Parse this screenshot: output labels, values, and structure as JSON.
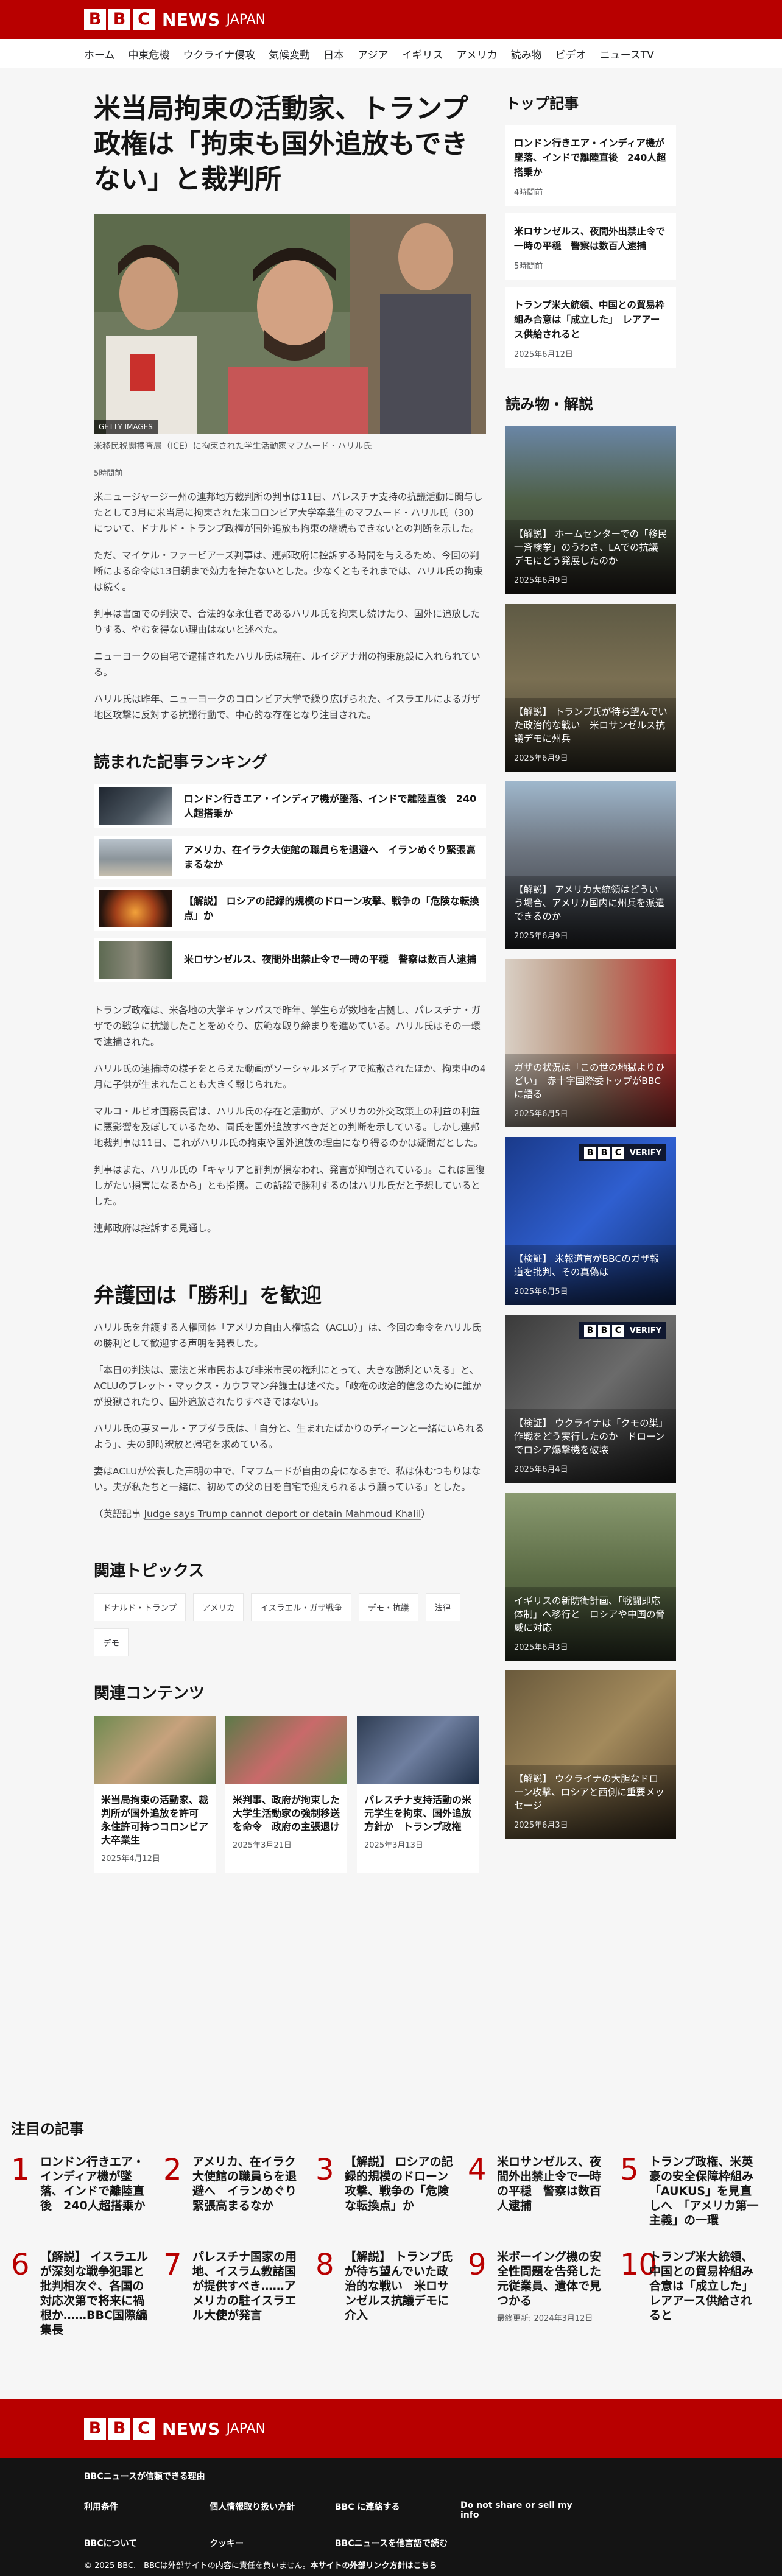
{
  "brand": {
    "blocks": [
      "B",
      "B",
      "C"
    ],
    "news": "NEWS",
    "edition": "JAPAN"
  },
  "nav": [
    "ホーム",
    "中東危機",
    "ウクライナ侵攻",
    "気候変動",
    "日本",
    "アジア",
    "イギリス",
    "アメリカ",
    "読み物",
    "ビデオ",
    "ニュースTV"
  ],
  "article": {
    "headline": "米当局拘束の活動家、トランプ政権は「拘束も国外追放もできない」と裁判所",
    "image_badge": "GETTY IMAGES",
    "caption": "米移民税関捜査局（ICE）に拘束された学生活動家マフムード・ハリル氏",
    "time": "5時間前",
    "paragraphs_1": [
      "米ニュージャージー州の連邦地方裁判所の判事は11日、パレスチナ支持の抗議活動に関与したとして3月に米当局に拘束された米コロンビア大学卒業生のマフムード・ハリル氏（30）について、ドナルド・トランプ政権が国外追放も拘束の継続もできないとの判断を示した。",
      "ただ、マイケル・ファービアーズ判事は、連邦政府に控訴する時間を与えるため、今回の判断による命令は13日朝まで効力を持たないとした。少なくともそれまでは、ハリル氏の拘束は続く。",
      "判事は書面での判決で、合法的な永住者であるハリル氏を拘束し続けたり、国外に追放したりする、やむを得ない理由はないと述べた。",
      "ニューヨークの自宅で逮捕されたハリル氏は現在、ルイジアナ州の拘束施設に入れられている。",
      "ハリル氏は昨年、ニューヨークのコロンビア大学で繰り広げられた、イスラエルによるガザ地区攻撃に反対する抗議行動で、中心的な存在となり注目された。"
    ],
    "ranking_title": "読まれた記事ランキング",
    "ranking": [
      "ロンドン行きエア・インディア機が墜落、インドで離陸直後　240人超搭乗か",
      "アメリカ、在イラク大使館の職員らを退避へ　イランめぐり緊張高まるなか",
      "【解説】 ロシアの記録的規模のドローン攻撃、戦争の「危険な転換点」か",
      "米ロサンゼルス、夜間外出禁止令で一時の平穏　警察は数百人逮捕"
    ],
    "paragraphs_2": [
      "トランプ政権は、米各地の大学キャンパスで昨年、学生らが数地を占拠し、パレスチナ・ガザでの戦争に抗議したことをめぐり、広範な取り締まりを進めている。ハリル氏はその一環で逮捕された。",
      "ハリル氏の逮捕時の様子をとらえた動画がソーシャルメディアで拡散されたほか、拘束中の4月に子供が生まれたことも大きく報じられた。",
      "マルコ・ルビオ国務長官は、ハリル氏の存在と活動が、アメリカの外交政策上の利益の利益に悪影響を及ぼしているため、同氏を国外追放すべきだとの判断を示している。しかし連邦地裁判事は11日、これがハリル氏の拘束や国外追放の理由になり得るのかは疑問だとした。",
      "判事はまた、ハリル氏の「キャリアと評判が損なわれ、発言が抑制されている」。これは回復しがたい損害になるから」とも指摘。この訴訟で勝利するのはハリル氏だと予想しているとした。",
      "連邦政府は控訴する見通し。"
    ],
    "h2": "弁護団は「勝利」を歓迎",
    "paragraphs_3": [
      "ハリル氏を弁護する人権団体「アメリカ自由人権協会（ACLU）」は、今回の命令をハリル氏の勝利として歓迎する声明を発表した。",
      "「本日の判決は、憲法と米市民および非米市民の権利にとって、大きな勝利といえる」と、ACLUのブレット・マックス・カウフマン弁護士は述べた。「政権の政治的信念のために誰かが投獄されたり、国外追放されたりすべきではない」。",
      "ハリル氏の妻ヌール・アブダラ氏は、「自分と、生まれたばかりのディーンと一緒にいられるよう」、夫の即時釈放と帰宅を求めている。",
      "妻はACLUが公表した声明の中で、「マフムードが自由の身になるまで、私は休むつもりはない。夫が私たちと一緒に、初めての父の日を自宅で迎えられるよう願っている」とした。"
    ],
    "english_label": "（英語記事",
    "english_link": "Judge says Trump cannot deport or detain Mahmoud Khalil",
    "english_close": "）",
    "topics_title": "関連トピックス",
    "topics": [
      "ドナルド・トランプ",
      "アメリカ",
      "イスラエル・ガザ戦争",
      "デモ・抗議",
      "法律",
      "デモ"
    ],
    "related_title": "関連コンテンツ",
    "related": [
      {
        "title": "米当局拘束の活動家、裁判所が国外追放を許可　永住許可持つコロンビア大卒業生",
        "date": "2025年4月12日"
      },
      {
        "title": "米判事、政府が拘束した大学生活動家の強制移送を命令　政府の主張退け",
        "date": "2025年3月21日"
      },
      {
        "title": "パレスチナ支持活動の米元学生を拘束、国外追放方針か　トランプ政権",
        "date": "2025年3月13日"
      }
    ]
  },
  "sidebar": {
    "top_title": "トップ記事",
    "top": [
      {
        "title": "ロンドン行きエア・インディア機が墜落、インドで離陸直後　240人超搭乗か",
        "date": "4時間前"
      },
      {
        "title": "米ロサンゼルス、夜間外出禁止令で一時の平穏　警察は数百人逮捕",
        "date": "5時間前"
      },
      {
        "title": "トランプ米大統領、中国との貿易枠組み合意は「成立した」　レアアース供給されると",
        "date": "2025年6月12日"
      }
    ],
    "features_title": "読み物・解説",
    "features": [
      {
        "title": "【解説】 ホームセンターでの「移民一斉検挙」のうわさ、LAでの抗議デモにどう発展したのか",
        "date": "2025年6月9日",
        "verify": false
      },
      {
        "title": "【解説】 トランプ氏が待ち望んでいた政治的な戦い　米ロサンゼルス抗議デモに州兵",
        "date": "2025年6月9日",
        "verify": false
      },
      {
        "title": "【解説】 アメリカ大統領はどういう場合、アメリカ国内に州兵を派遣できるのか",
        "date": "2025年6月9日",
        "verify": false
      },
      {
        "title": "ガザの状況は「この世の地獄よりひどい」　赤十字国際委トップがBBCに語る",
        "date": "2025年6月5日",
        "verify": false
      },
      {
        "title": "【検証】 米報道官がBBCのガザ報道を批判、その真偽は",
        "date": "2025年6月5日",
        "verify": true
      },
      {
        "title": "【検証】 ウクライナは「クモの巣」作戦をどう実行したのか　ドローンでロシア爆撃機を破壊",
        "date": "2025年6月4日",
        "verify": true
      },
      {
        "title": "イギリスの新防衛計画、「戦闘即応体制」へ移行と　ロシアや中国の脅威に対応",
        "date": "2025年6月3日",
        "verify": false
      },
      {
        "title": "【解説】 ウクライナの大胆なドローン攻撃、ロシアと西側に重要メッセージ",
        "date": "2025年6月3日",
        "verify": false
      }
    ],
    "verify_label": "VERIFY"
  },
  "most_read": {
    "title": "注目の記事",
    "items": [
      {
        "num": "1",
        "text": "ロンドン行きエア・インディア機が墜落、インドで離陸直後　240人超搭乗か",
        "sub": ""
      },
      {
        "num": "2",
        "text": "アメリカ、在イラク大使館の職員らを退避へ　イランめぐり緊張高まるなか",
        "sub": ""
      },
      {
        "num": "3",
        "text": "【解説】 ロシアの記録的規模のドローン攻撃、戦争の「危険な転換点」か",
        "sub": ""
      },
      {
        "num": "4",
        "text": "米ロサンゼルス、夜間外出禁止令で一時の平穏　警察は数百人逮捕",
        "sub": ""
      },
      {
        "num": "5",
        "text": "トランプ政権、米英豪の安全保障枠組み「AUKUS」を見直しへ　「アメリカ第一主義」の一環",
        "sub": ""
      },
      {
        "num": "6",
        "text": "【解説】 イスラエルが深刻な戦争犯罪と批判相次ぐ、各国の対応次第で将来に禍根か……BBC国際編集長",
        "sub": ""
      },
      {
        "num": "7",
        "text": "パレスチナ国家の用地、イスラム教諸国が提供すべき……アメリカの駐イスラエル大使が発言",
        "sub": ""
      },
      {
        "num": "8",
        "text": "【解説】 トランプ氏が待ち望んでいた政治的な戦い　米ロサンゼルス抗議デモに介入",
        "sub": ""
      },
      {
        "num": "9",
        "text": "米ボーイング機の安全性問題を告発した元従業員、遺体で見つかる",
        "sub": "最終更新: 2024年3月12日"
      },
      {
        "num": "10",
        "text": "トランプ米大統領、中国との貿易枠組み合意は「成立した」　レアアース供給されると",
        "sub": ""
      }
    ]
  },
  "footer": {
    "trust": "BBCニュースが信頼できる理由",
    "links": [
      "利用条件",
      "個人情報取り扱い方針",
      "BBC に連絡する",
      "Do not share or sell my info",
      "BBCについて",
      "クッキー",
      "BBCニュースを他言語で読む"
    ],
    "copyright": "© 2025 BBC.　BBCは外部サイトの内容に責任を負いません。",
    "copyright_link": "本サイトの外部リンク方針はこちら"
  }
}
